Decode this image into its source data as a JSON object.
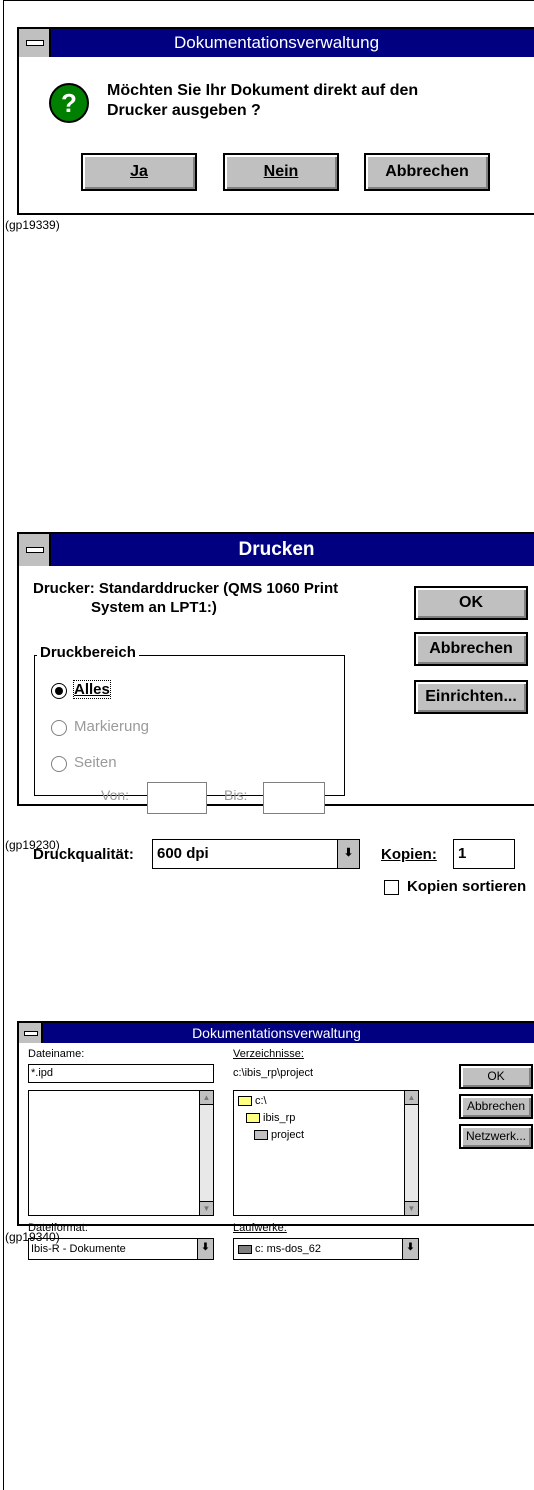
{
  "dialog1": {
    "title": "Dokumentationsverwaltung",
    "message_line1": "Möchten Sie Ihr Dokument direkt auf den",
    "message_line2": "Drucker ausgeben ?",
    "icon": "question-icon",
    "buttons": {
      "yes": "Ja",
      "no": "Nein",
      "cancel": "Abbrechen"
    },
    "caption": "(gp19339)"
  },
  "dialog2": {
    "title": "Drucken",
    "printer_line1": "Drucker: Standarddrucker (QMS 1060 Print",
    "printer_line2": "System an LPT1:)",
    "buttons": {
      "ok": "OK",
      "cancel": "Abbrechen",
      "setup": "Einrichten..."
    },
    "range_group": {
      "title": "Druckbereich",
      "options": [
        "Alles",
        "Markierung",
        "Seiten"
      ],
      "selected": "Alles",
      "from_label": "Von:",
      "to_label": "Bis:",
      "from_value": "",
      "to_value": ""
    },
    "quality_label": "Druckqualität:",
    "quality_value": "600 dpi",
    "copies_label": "Kopien:",
    "copies_value": "1",
    "collate_label": "Kopien sortieren",
    "collate_checked": false,
    "caption": "(gp19230)"
  },
  "dialog3": {
    "title": "Dokumentationsverwaltung",
    "filename_label": "Dateiname:",
    "filename_value": "*.ipd",
    "directories_label": "Verzeichnisse:",
    "current_path": "c:\\ibis_rp\\project",
    "dir_items": [
      "c:\\",
      "ibis_rp",
      "project"
    ],
    "fileformat_label": "Dateiformat:",
    "fileformat_value": "Ibis-R - Dokumente",
    "drives_label": "Laufwerke:",
    "drive_value": "c: ms-dos_62",
    "buttons": {
      "ok": "OK",
      "cancel": "Abbrechen",
      "network": "Netzwerk..."
    },
    "caption": "(gp19340)"
  },
  "colors": {
    "titlebar": "#000080",
    "button_face": "#c0c0c0",
    "question_icon": "#008000"
  }
}
